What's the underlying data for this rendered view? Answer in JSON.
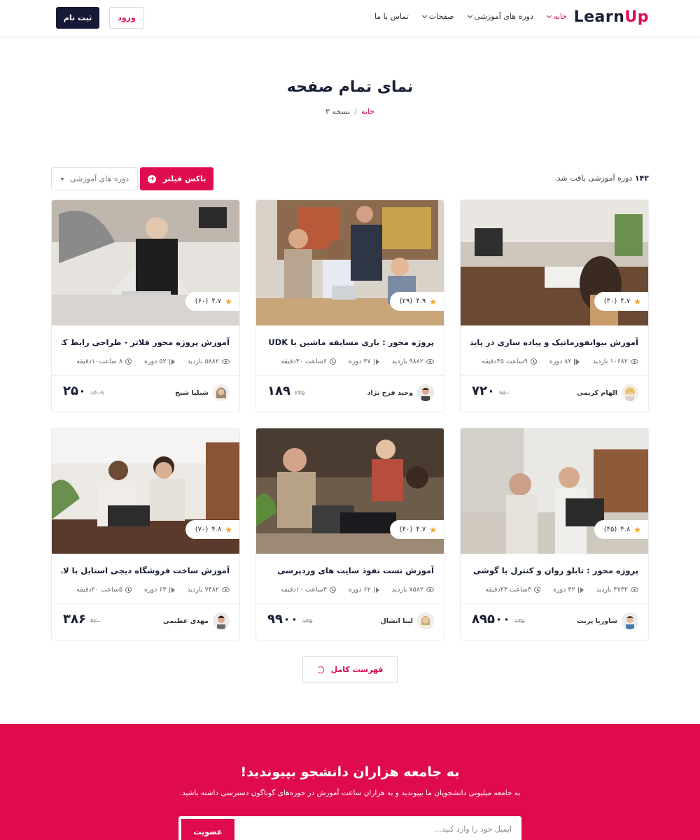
{
  "header": {
    "logo": {
      "learn": "Learn",
      "up": "Up"
    },
    "nav": [
      {
        "label": "خانه",
        "has_dropdown": true,
        "active": true
      },
      {
        "label": "دوره های آموزشی",
        "has_dropdown": true,
        "active": false
      },
      {
        "label": "صفحات",
        "has_dropdown": true,
        "active": false
      },
      {
        "label": "تماس با ما",
        "has_dropdown": false,
        "active": false
      }
    ],
    "login_label": "ورود",
    "signup_label": "ثبت نام"
  },
  "page": {
    "title": "نمای تمام صفحه",
    "breadcrumb": {
      "home": "خانه",
      "separator": "/",
      "current": "نسخه ۳"
    }
  },
  "toolbar": {
    "found_count": "۱۴۲",
    "found_text": "دوره آموزشی یافت شد.",
    "filter_label": "باکس فیلتر",
    "select_label": "دوره های آموزشی"
  },
  "courses": [
    {
      "title": "آموزش بیوانفورماتیک و پیاده سازی در پایتون",
      "rating": "۴.۷",
      "reviews": "(۴۰)",
      "views": "۱۰۶۸۲ بازدید",
      "lessons": "۸۲ دوره",
      "duration": "۹ساعت ۴۵دقیقه",
      "teacher": "الهام کریمی",
      "price": "۷۲۰",
      "old_price": "۹۸۰"
    },
    {
      "title": "پروژه محور : بازی مسابقه ماشین با UDK",
      "rating": "۴.۹",
      "reviews": "(۲۹)",
      "views": "۹۸۸۲ بازدید",
      "lessons": "۴۷ دوره",
      "duration": "۶ساعت ۳۰دقیقه",
      "teacher": "وحید فرخ نژاد",
      "price": "۱۸۹",
      "old_price": "۲۳۵"
    },
    {
      "title": "آموزش پروژه محور فلاتر - طراحی رابط کاربری UI",
      "rating": "۴.۷",
      "reviews": "(۶۰)",
      "views": "۵۸۸۲ بازدید",
      "lessons": "۵۲ دوره",
      "duration": "۸ ساعت۱۰دقیقه",
      "teacher": "شیلیا شیخ",
      "price": "۲۵۰",
      "old_price": "۱۴۰۹"
    },
    {
      "title": "پروژه محور : تابلو روان و کنترل با گوشی",
      "rating": "۴.۸",
      "reviews": "(۴۵)",
      "views": "۴۷۳۲ بازدید",
      "lessons": "۳۲ دوره",
      "duration": "۳ساعت ۲۳دقیقه",
      "teacher": "شاوریا پریت",
      "price": "۸۹۵۰۰",
      "old_price": "۱۳۵"
    },
    {
      "title": "آموزش تست نفوذ سایت های وردپرسی",
      "rating": "۴.۷",
      "reviews": "(۴۰)",
      "views": "۷۵۸۲ بازدید",
      "lessons": "۶۲ دوره",
      "duration": "۳ساعت ۱۰دقیقه",
      "teacher": "لینا انشال",
      "price": "۹۹۰۰",
      "old_price": "۱۴۵"
    },
    {
      "title": "آموزش ساخت فروشگاه دیجی استایل با لاراول",
      "rating": "۴.۸",
      "reviews": "(۷۰)",
      "views": "۷۴۸۲ بازدید",
      "lessons": "۶۳ دوره",
      "duration": "۵ساعت ۲۰دقیقه",
      "teacher": "مهدی عظیمی",
      "price": "۳۸۶",
      "old_price": "۴۲۰"
    }
  ],
  "full_list_label": "فهرست کامل",
  "newsletter": {
    "title": "به جامعه هزاران دانشجو بپیوندید!",
    "subtitle": "به جامعه میلیونی دانشجویان ما بپیوندید و به هزاران ساعت آموزش در حوزه‌های گوناگون دسترسی داشته باشید.",
    "placeholder": "ایمیل خود را وارد کنید...",
    "button_label": "عضویت"
  },
  "colors": {
    "accent": "#df0b4c",
    "dark": "#161a36",
    "star": "#f6a623"
  }
}
